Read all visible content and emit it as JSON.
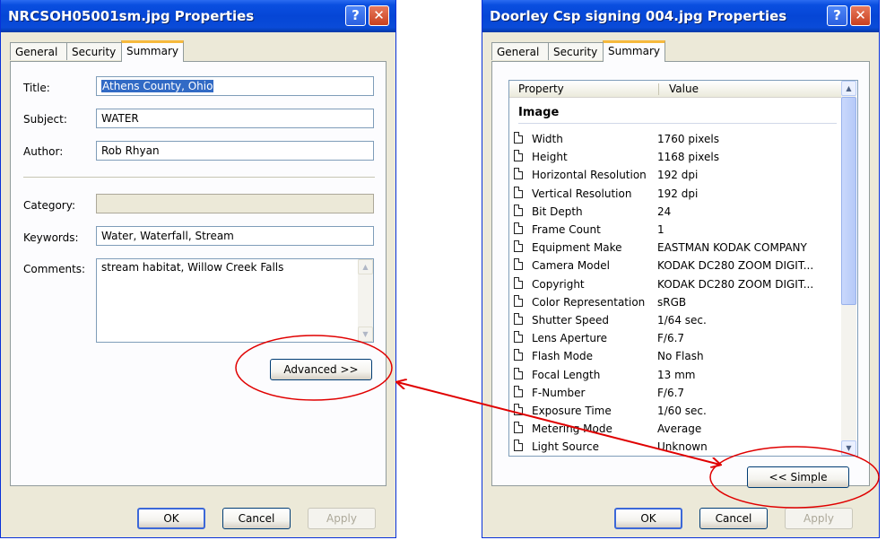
{
  "left_dialog": {
    "title": "NRCSOH05001sm.jpg Properties",
    "help_glyph": "?",
    "close_glyph": "✕",
    "tabs": [
      "General",
      "Security",
      "Summary"
    ],
    "fields": {
      "title_label": "Title:",
      "title_value": "Athens County, Ohio",
      "subject_label": "Subject:",
      "subject_value": "WATER",
      "author_label": "Author:",
      "author_value": "Rob Rhyan",
      "category_label": "Category:",
      "category_value": "",
      "keywords_label": "Keywords:",
      "keywords_value": "Water, Waterfall, Stream",
      "comments_label": "Comments:",
      "comments_value": "stream habitat, Willow Creek Falls"
    },
    "advanced_label": "Advanced >>",
    "ok_label": "OK",
    "cancel_label": "Cancel",
    "apply_label": "Apply"
  },
  "right_dialog": {
    "title": "Doorley Csp signing 004.jpg Properties",
    "help_glyph": "?",
    "close_glyph": "✕",
    "tabs": [
      "General",
      "Security",
      "Summary"
    ],
    "columns": [
      "Property",
      "Value"
    ],
    "group": "Image",
    "properties": [
      {
        "name": "Width",
        "value": "1760 pixels"
      },
      {
        "name": "Height",
        "value": "1168 pixels"
      },
      {
        "name": "Horizontal Resolution",
        "value": "192 dpi"
      },
      {
        "name": "Vertical Resolution",
        "value": "192 dpi"
      },
      {
        "name": "Bit Depth",
        "value": "24"
      },
      {
        "name": "Frame Count",
        "value": "1"
      },
      {
        "name": "Equipment Make",
        "value": "EASTMAN KODAK COMPANY"
      },
      {
        "name": "Camera Model",
        "value": "KODAK DC280 ZOOM DIGIT..."
      },
      {
        "name": "Copyright",
        "value": "KODAK DC280 ZOOM DIGIT..."
      },
      {
        "name": "Color Representation",
        "value": "sRGB"
      },
      {
        "name": "Shutter Speed",
        "value": "1/64 sec."
      },
      {
        "name": "Lens Aperture",
        "value": "F/6.7"
      },
      {
        "name": "Flash Mode",
        "value": "No Flash"
      },
      {
        "name": "Focal Length",
        "value": "13 mm"
      },
      {
        "name": "F-Number",
        "value": "F/6.7"
      },
      {
        "name": "Exposure Time",
        "value": "1/60 sec."
      },
      {
        "name": "Metering Mode",
        "value": "Average"
      },
      {
        "name": "Light Source",
        "value": "Unknown"
      }
    ],
    "simple_label": "<< Simple",
    "ok_label": "OK",
    "cancel_label": "Cancel",
    "apply_label": "Apply"
  },
  "colors": {
    "annotation": "#e00000",
    "title_bar": "#0546d6",
    "dialog_face": "#ece9d8",
    "active_tab_highlight": "#f6b93d"
  }
}
